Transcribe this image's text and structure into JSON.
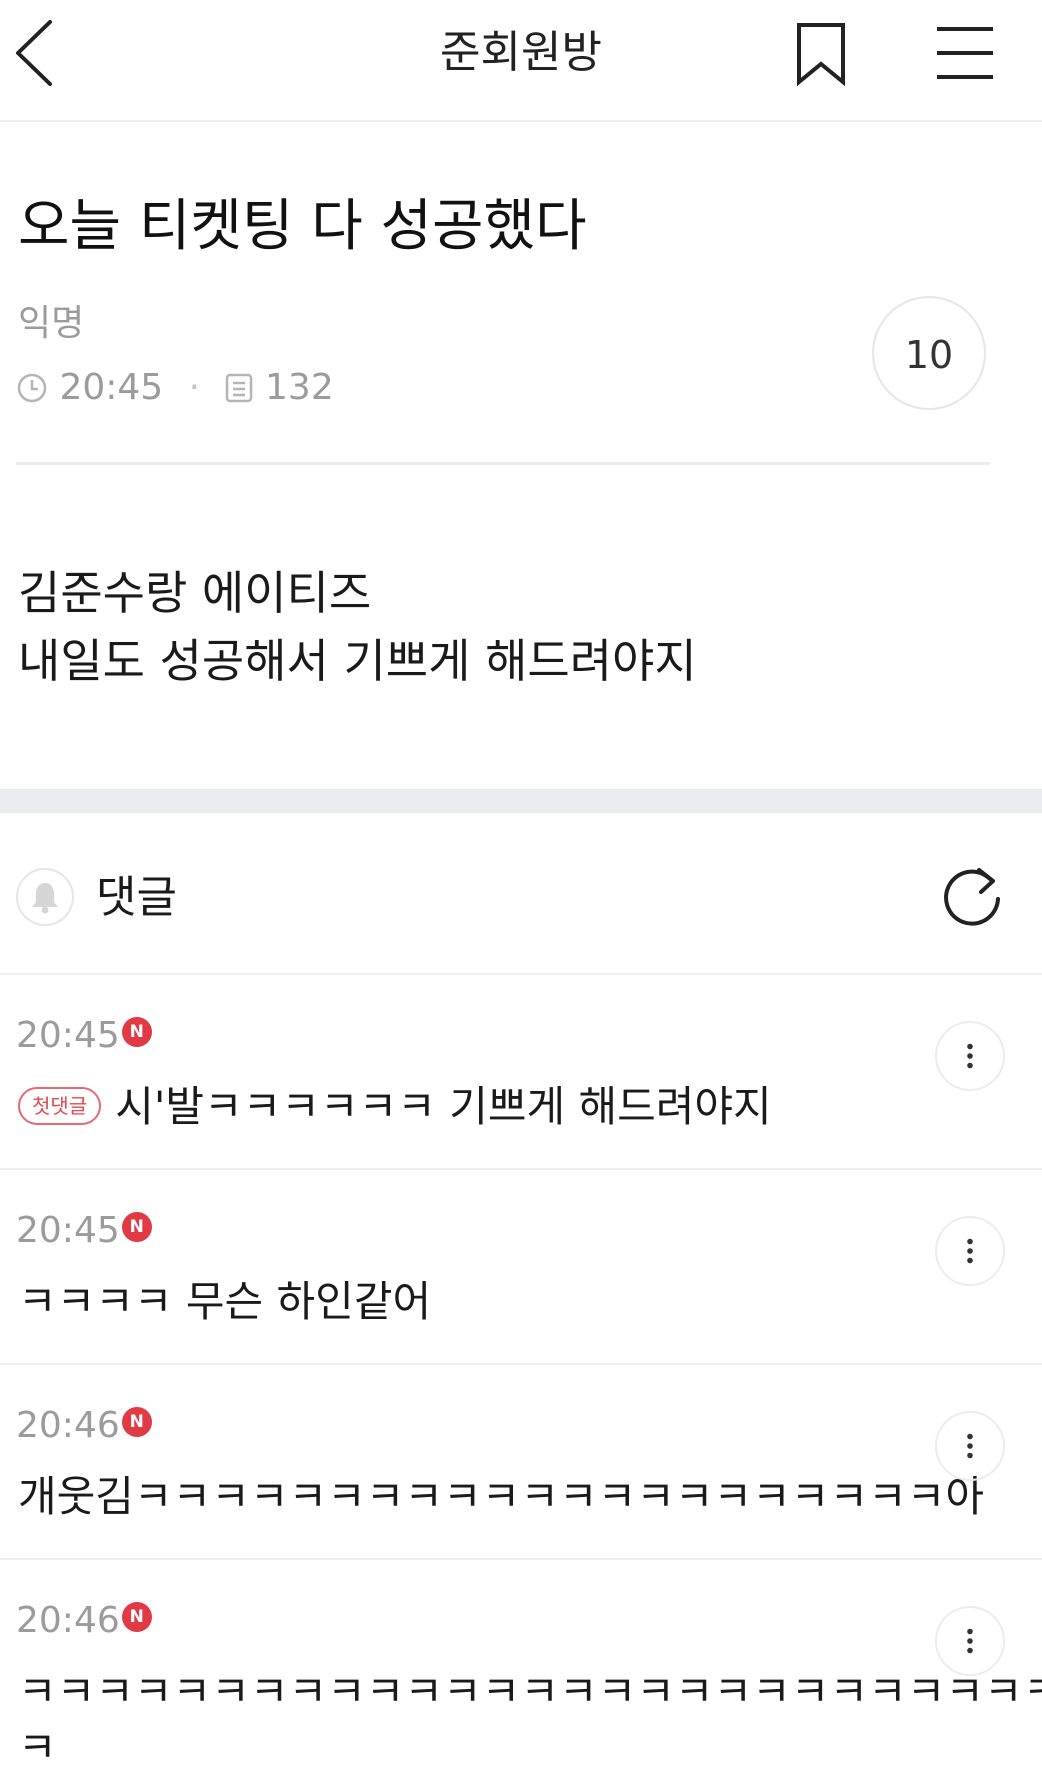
{
  "header": {
    "title": "준회원방",
    "back_icon": "chevron-left-icon",
    "bookmark_icon": "bookmark-icon",
    "menu_icon": "hamburger-menu-icon"
  },
  "post": {
    "title": "오늘 티켓팅 다 성공했다",
    "author": "익명",
    "time": "20:45",
    "views": "132",
    "likes": "10",
    "body_lines": [
      "김준수랑 에이티즈",
      "내일도 성공해서 기쁘게 해드려야지"
    ]
  },
  "comments_section": {
    "label": "댓글",
    "bell_icon": "bell-icon",
    "refresh_icon": "refresh-icon"
  },
  "colors": {
    "new_badge": "#e03a45",
    "first_badge": "#e04a50",
    "meta_gray": "#9b9b9b",
    "section_gap": "#e9ebee"
  },
  "comments": [
    {
      "time": "20:45",
      "new_badge": "N",
      "first_badge": "첫댓글",
      "text": "시'발ㅋㅋㅋㅋㅋㅋ 기쁘게 해드려야지"
    },
    {
      "time": "20:45",
      "new_badge": "N",
      "text": "ㅋㅋㅋㅋ 무슨 하인같어"
    },
    {
      "time": "20:46",
      "new_badge": "N",
      "text": "개웃김ㅋㅋㅋㅋㅋㅋㅋㅋㅋㅋㅋㅋㅋㅋㅋㅋㅋㅋㅋㅋㅋ아"
    },
    {
      "time": "20:46",
      "new_badge": "N",
      "text": "ㅋㅋㅋㅋㅋㅋㅋㅋㅋㅋㅋㅋㅋㅋㅋㅋㅋㅋㅋㅋㅋㅋㅋㅋㅋㅋㅋ",
      "text_cont": "ㅋ"
    }
  ]
}
